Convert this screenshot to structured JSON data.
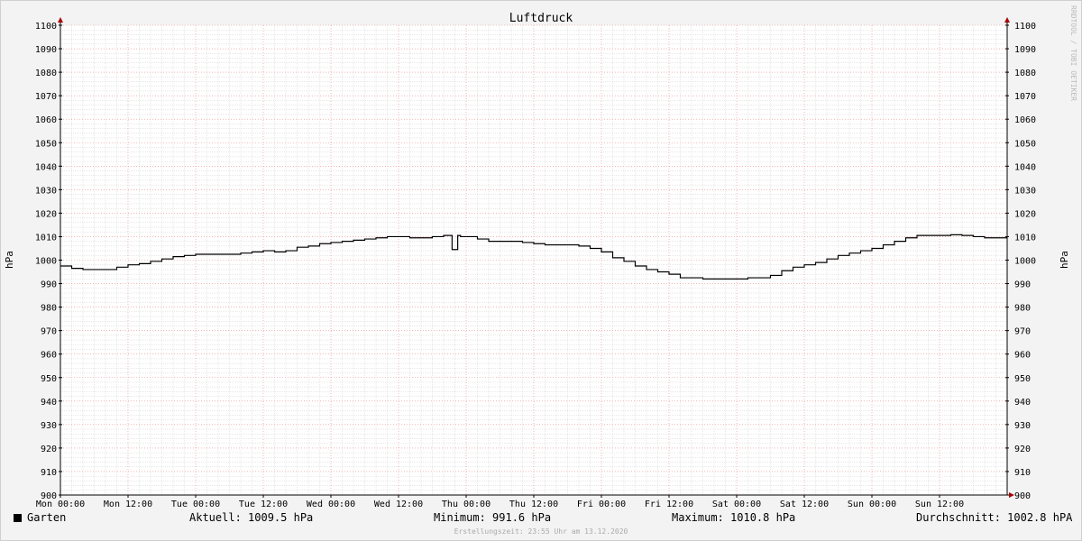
{
  "chart_data": {
    "type": "line",
    "title": "Luftdruck",
    "ylabel": "hPa",
    "ylabel_right": "hPa",
    "ylim": [
      900,
      1100
    ],
    "y_ticks": [
      900,
      910,
      920,
      930,
      940,
      950,
      960,
      970,
      980,
      990,
      1000,
      1010,
      1020,
      1030,
      1040,
      1050,
      1060,
      1070,
      1080,
      1090,
      1100
    ],
    "x_unit": "hours",
    "xlim": [
      0,
      168
    ],
    "x_ticks": [
      {
        "x": 0,
        "label": "Mon 00:00"
      },
      {
        "x": 12,
        "label": "Mon 12:00"
      },
      {
        "x": 24,
        "label": "Tue 00:00"
      },
      {
        "x": 36,
        "label": "Tue 12:00"
      },
      {
        "x": 48,
        "label": "Wed 00:00"
      },
      {
        "x": 60,
        "label": "Wed 12:00"
      },
      {
        "x": 72,
        "label": "Thu 00:00"
      },
      {
        "x": 84,
        "label": "Thu 12:00"
      },
      {
        "x": 96,
        "label": "Fri 00:00"
      },
      {
        "x": 108,
        "label": "Fri 12:00"
      },
      {
        "x": 120,
        "label": "Sat 00:00"
      },
      {
        "x": 132,
        "label": "Sat 12:00"
      },
      {
        "x": 144,
        "label": "Sun 00:00"
      },
      {
        "x": 156,
        "label": "Sun 12:00"
      }
    ],
    "grid": true,
    "legend_position": "bottom-left",
    "series": [
      {
        "name": "Garten",
        "color": "#000000",
        "x": [
          0,
          2,
          4,
          6,
          8,
          10,
          12,
          14,
          16,
          18,
          20,
          22,
          24,
          26,
          28,
          30,
          32,
          34,
          36,
          38,
          40,
          42,
          44,
          46,
          48,
          50,
          52,
          54,
          56,
          58,
          60,
          62,
          64,
          66,
          68,
          69,
          69.5,
          70,
          70.5,
          71,
          74,
          76,
          78,
          80,
          82,
          84,
          86,
          88,
          90,
          92,
          94,
          96,
          98,
          100,
          102,
          104,
          106,
          108,
          110,
          112,
          114,
          116,
          118,
          120,
          122,
          124,
          126,
          128,
          130,
          132,
          134,
          136,
          138,
          140,
          142,
          144,
          146,
          148,
          150,
          152,
          154,
          156,
          158,
          160,
          162,
          164,
          166
        ],
        "values": [
          997.5,
          996.5,
          996,
          996,
          996,
          997,
          998,
          998.5,
          999.5,
          1000.5,
          1001.5,
          1002,
          1002.5,
          1002.5,
          1002.5,
          1002.5,
          1003,
          1003.5,
          1004,
          1003.5,
          1004,
          1005.5,
          1006,
          1007,
          1007.5,
          1008,
          1008.5,
          1009,
          1009.5,
          1010,
          1010,
          1009.5,
          1009.5,
          1010,
          1010.5,
          1010.5,
          1004.5,
          1004.5,
          1010.5,
          1010,
          1009,
          1008,
          1008,
          1008,
          1007.5,
          1007,
          1006.5,
          1006.5,
          1006.5,
          1006,
          1005,
          1003.5,
          1001,
          999.5,
          997.5,
          996,
          995,
          994,
          992.5,
          992.5,
          992,
          992,
          992,
          992,
          992.5,
          992.5,
          993.5,
          995.5,
          997,
          998,
          999,
          1000.5,
          1002,
          1003,
          1004,
          1005,
          1006.5,
          1008,
          1009.5,
          1010.5,
          1010.5,
          1010.5,
          1010.8,
          1010.5,
          1010,
          1009.5,
          1009.5
        ]
      }
    ]
  },
  "legend": {
    "series_name": "Garten",
    "current": "Aktuell: 1009.5 hPa",
    "minimum": "Minimum: 991.6 hPa",
    "maximum": "Maximum: 1010.8 hPa",
    "average": "Durchschnitt: 1002.8 hPA"
  },
  "footer": "Erstellungszeit: 23:55 Uhr am 13.12.2020",
  "watermark": "RRDTOOL / TOBI OETIKER",
  "colors": {
    "background": "#f3f3f3",
    "canvas": "#ffffff",
    "major_grid": "#e88a8a",
    "minor_grid": "#d0d0d0",
    "axis": "#000000",
    "arrow": "#aa0000"
  }
}
